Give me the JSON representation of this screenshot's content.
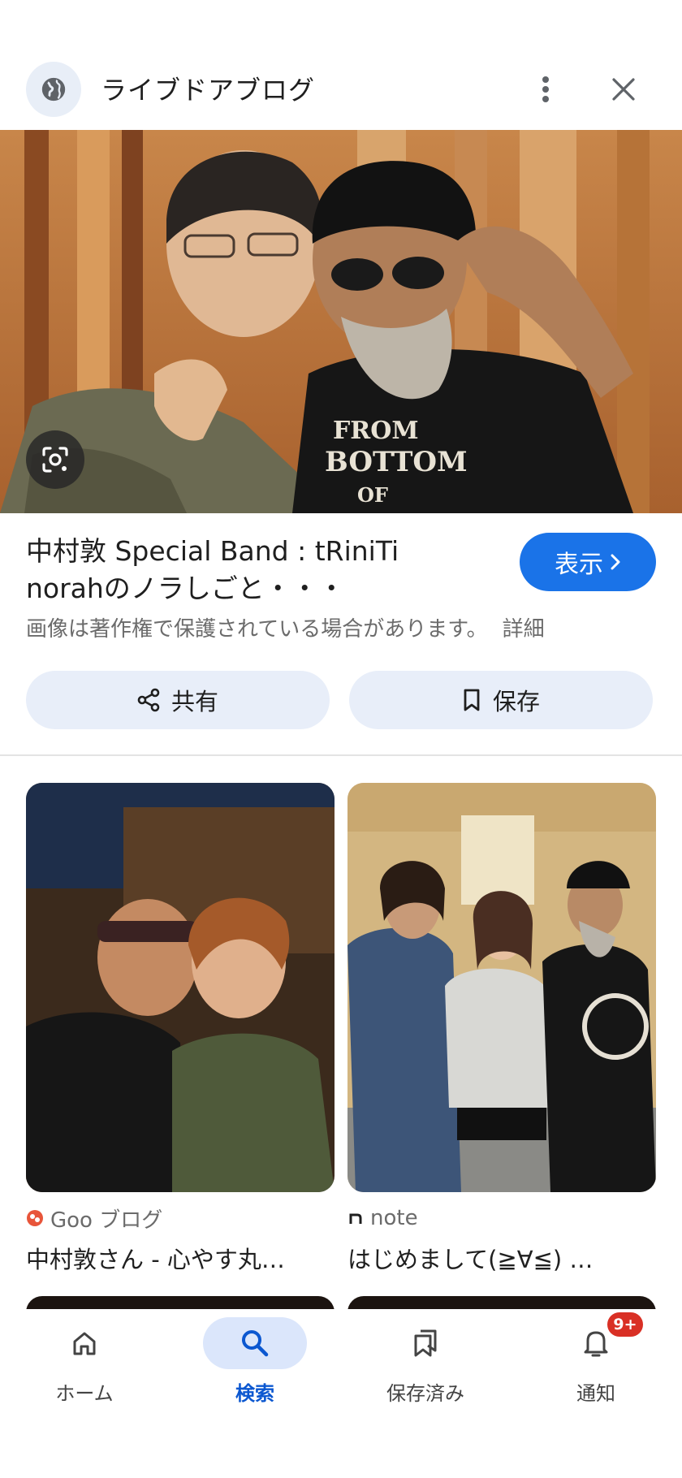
{
  "header": {
    "site_name": "ライブドアブログ",
    "icons": {
      "site": "globe-icon",
      "more": "more-vert-icon",
      "close": "close-icon"
    }
  },
  "hero": {
    "lens_icon": "lens-camera-icon"
  },
  "result": {
    "title_line1": "中村敦 Special Band : tRiniTi",
    "title_line2": "norahのノラしごと・・・",
    "visit_label": "表示",
    "copyright_notice": "画像は著作権で保護されている場合があります。",
    "detail_link": "詳細"
  },
  "actions": {
    "share_label": "共有",
    "save_label": "保存"
  },
  "related": [
    {
      "source": "Goo ブログ",
      "caption": "中村敦さん - 心やす丸…"
    },
    {
      "source": "note",
      "caption": "はじめまして(≧∀≦) …"
    }
  ],
  "nav": {
    "items": [
      {
        "label": "ホーム",
        "icon": "home-icon"
      },
      {
        "label": "検索",
        "icon": "search-icon",
        "active": true
      },
      {
        "label": "保存済み",
        "icon": "collections-icon"
      },
      {
        "label": "通知",
        "icon": "bell-icon",
        "badge": "9+"
      }
    ]
  },
  "colors": {
    "accent": "#1a73e8",
    "active_nav": "#0b57d0",
    "badge": "#d93025",
    "chip_bg": "#e8eef9"
  }
}
